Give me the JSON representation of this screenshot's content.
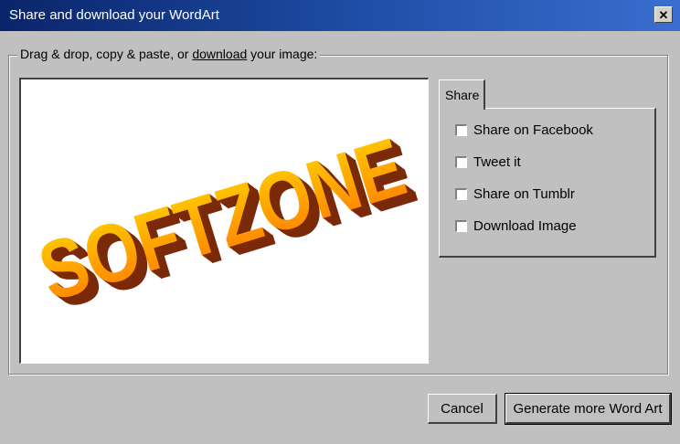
{
  "window": {
    "title": "Share and download your WordArt",
    "close_label": "✕"
  },
  "group": {
    "legend_before": "Drag & drop, copy & paste, or ",
    "legend_link": "download",
    "legend_after": " your image:"
  },
  "preview": {
    "wordart_text": "SOFTZONE",
    "colors": {
      "top": "#ffd400",
      "bottom": "#ff7a00",
      "extrusion": "#7a2a08"
    }
  },
  "share_tab": {
    "label": "Share",
    "options": [
      {
        "label": "Share on Facebook",
        "checked": false
      },
      {
        "label": "Tweet it",
        "checked": false
      },
      {
        "label": "Share on Tumblr",
        "checked": false
      },
      {
        "label": "Download Image",
        "checked": false
      }
    ]
  },
  "buttons": {
    "cancel": "Cancel",
    "generate": "Generate more Word Art"
  }
}
